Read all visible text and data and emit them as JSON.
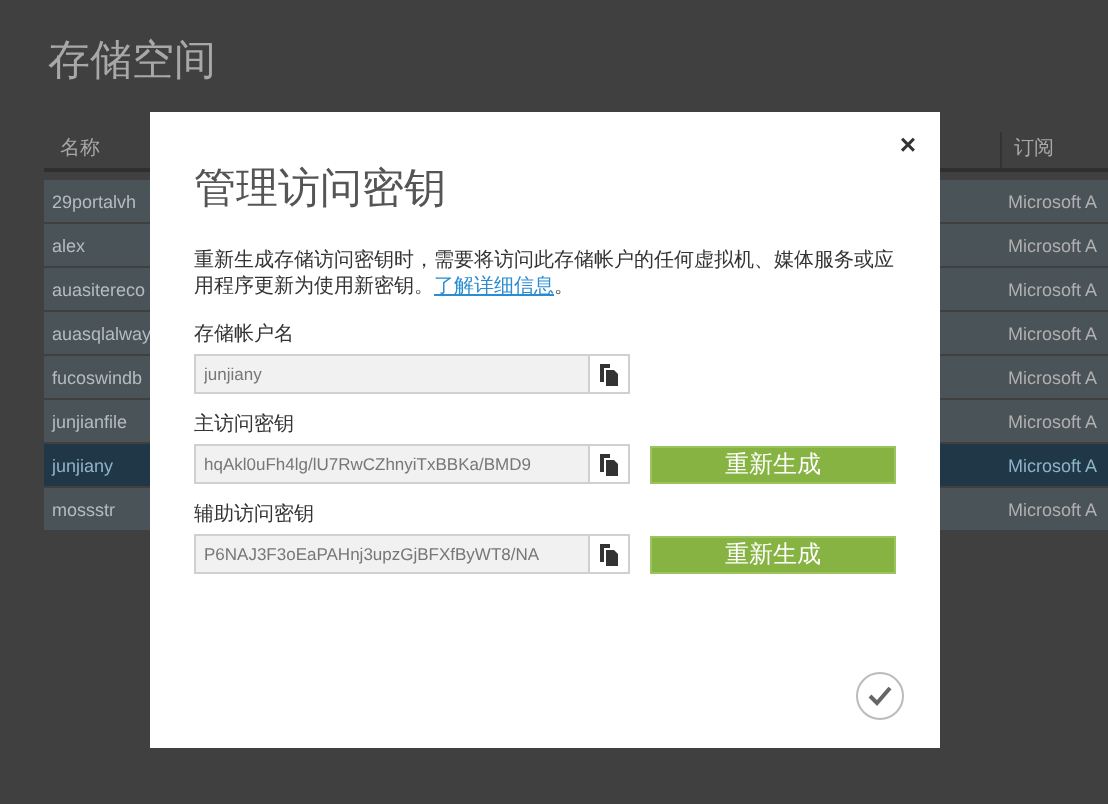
{
  "page": {
    "title": "存储空间"
  },
  "table": {
    "columns": [
      "名称",
      "订阅"
    ],
    "rows": [
      {
        "name": "29portalvh",
        "subscription": "Microsoft A",
        "selected": false
      },
      {
        "name": "alex",
        "subscription": "Microsoft A",
        "selected": false
      },
      {
        "name": "auasitereco",
        "subscription": "Microsoft A",
        "selected": false
      },
      {
        "name": "auasqlalway",
        "subscription": "Microsoft A",
        "selected": false
      },
      {
        "name": "fucoswindb",
        "subscription": "Microsoft A",
        "selected": false
      },
      {
        "name": "junjianfile",
        "subscription": "Microsoft A",
        "selected": false
      },
      {
        "name": "junjiany",
        "subscription": "Microsoft A",
        "selected": true
      },
      {
        "name": "mossstr",
        "subscription": "Microsoft A",
        "selected": false
      }
    ]
  },
  "dialog": {
    "title": "管理访问密钥",
    "close": "×",
    "intro": "重新生成存储访问密钥时，需要将访问此存储帐户的任何虚拟机、媒体服务或应用程序更新为使用新密钥。",
    "link": "了解详细信息",
    "intro_end": "。",
    "fields": [
      {
        "label": "存储帐户名",
        "value": "junjiany"
      },
      {
        "label": "主访问密钥",
        "value": "hqAkl0uFh4lg/lU7RwCZhnyiTxBBKa/BMD9",
        "button": "重新生成"
      },
      {
        "label": "辅助访问密钥",
        "value": "P6NAJ3F3oEaPAHnj3upzGjBFXfByWT8/NA",
        "button": "重新生成"
      }
    ]
  }
}
